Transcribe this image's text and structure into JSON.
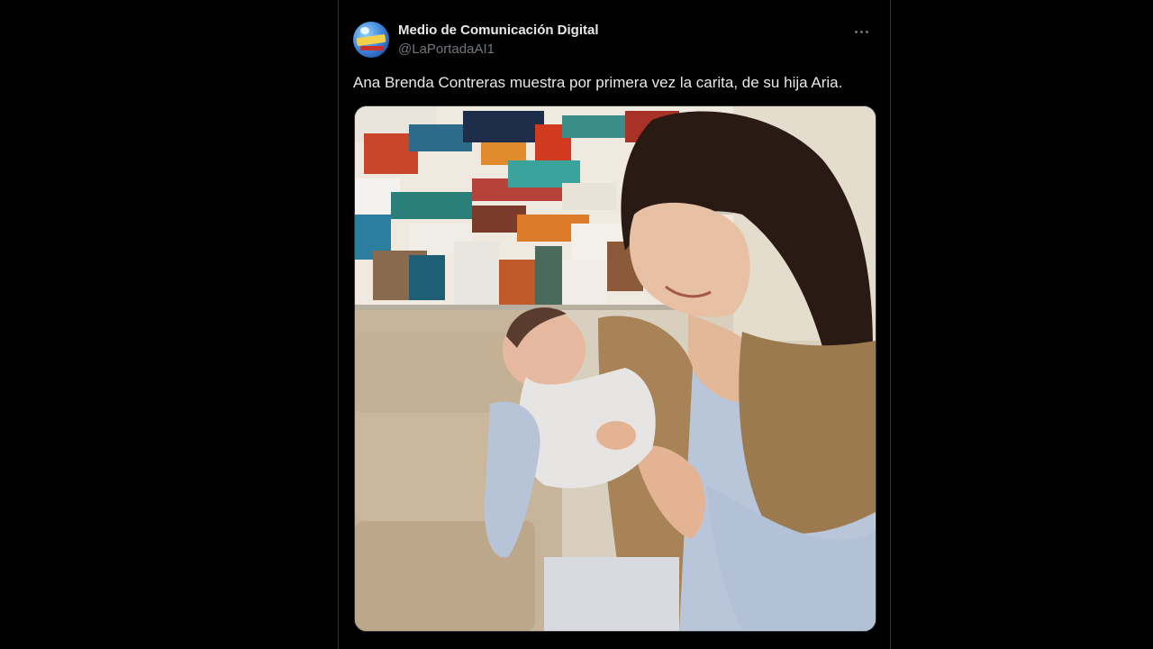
{
  "tweet": {
    "author_name": "Medio de Comunicación Digital",
    "author_handle": "@LaPortadaAI1",
    "text": "Ana Brenda Contreras muestra por primera vez la carita, de su hija Aria.",
    "avatar_icon": "news-logo-avatar",
    "more_icon": "more-options-icon",
    "media_alt": "Woman holding a newborn baby in front of an abstract painting"
  },
  "colors": {
    "background": "#000000",
    "text_primary": "#e7e9ea",
    "text_secondary": "#71767b",
    "border": "#2f3336"
  }
}
